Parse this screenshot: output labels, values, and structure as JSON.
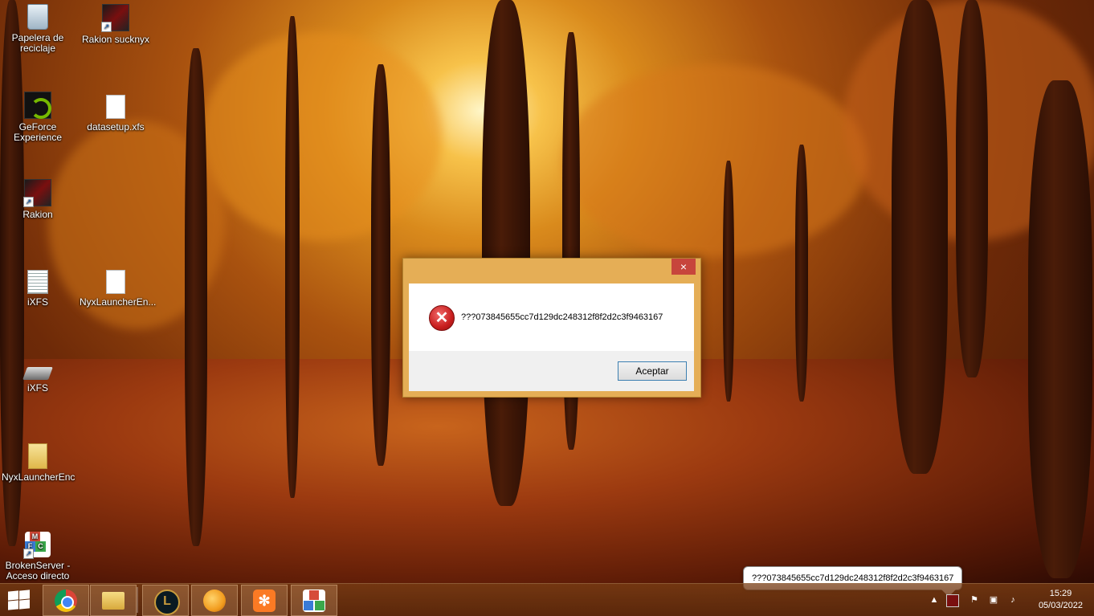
{
  "desktop": {
    "icons": [
      {
        "label": "Papelera de\nreciclaje",
        "icon": "recycle-bin-icon"
      },
      {
        "label": "Rakion sucknyx",
        "icon": "rakion-icon"
      },
      {
        "label": "GeForce\nExperience",
        "icon": "nvidia-icon"
      },
      {
        "label": "datasetup.xfs",
        "icon": "file-icon"
      },
      {
        "label": "Rakion",
        "icon": "rakion-icon"
      },
      {
        "label": "iXFS",
        "icon": "text-file-icon"
      },
      {
        "label": "NyxLauncherEn...",
        "icon": "file-icon"
      },
      {
        "label": "iXFS",
        "icon": "drive-icon"
      },
      {
        "label": "NyxLauncherEnc",
        "icon": "folder-icon"
      },
      {
        "label": "BrokenServer -\nAcceso directo",
        "icon": "mfc-icon"
      }
    ]
  },
  "dialog": {
    "close_label": "×",
    "message": "???073845655cc7d129dc248312f8f2d2c3f9463167",
    "ok_label": "Aceptar",
    "icon": "error-icon"
  },
  "taskbar": {
    "pinned": [
      {
        "name": "chrome",
        "color": "#db4437"
      },
      {
        "name": "file-explorer",
        "color": "#f2c94c"
      },
      {
        "name": "league-of-legends",
        "color": "#c89b3c"
      },
      {
        "name": "app-orange",
        "color": "#f29d1f"
      },
      {
        "name": "xampp",
        "color": "#fb7a24"
      },
      {
        "name": "mfc-app",
        "color": "#d64b3a"
      }
    ],
    "tray": {
      "time": "15:29",
      "date": "05/03/2022",
      "notification": "???073845655cc7d129dc248312f8f2d2c3f9463167"
    }
  }
}
